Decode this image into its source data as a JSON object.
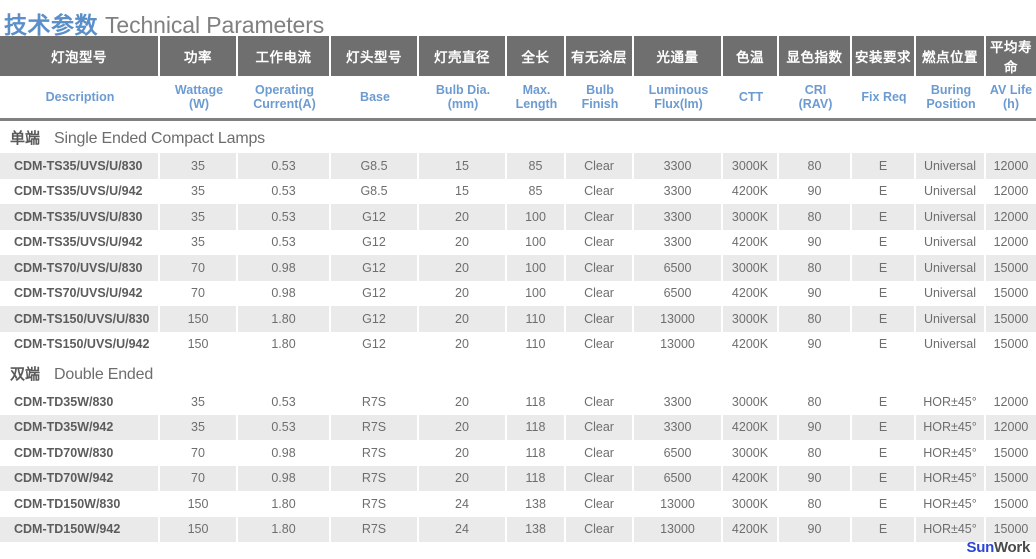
{
  "title": {
    "cn": "技术参数",
    "en": "Technical Parameters"
  },
  "columns": [
    {
      "cn": "灯泡型号",
      "en": "Description"
    },
    {
      "cn": "功率",
      "en": "Wattage\n(W)"
    },
    {
      "cn": "工作电流",
      "en": "Operating\nCurrent(A)"
    },
    {
      "cn": "灯头型号",
      "en": "Base"
    },
    {
      "cn": "灯壳直径",
      "en": "Bulb Dia.\n(mm)"
    },
    {
      "cn": "全长",
      "en": "Max.\nLength"
    },
    {
      "cn": "有无涂层",
      "en": "Bulb\nFinish"
    },
    {
      "cn": "光通量",
      "en": "Luminous\nFlux(lm)"
    },
    {
      "cn": "色温",
      "en": "CTT"
    },
    {
      "cn": "显色指数",
      "en": "CRI\n(RAV)"
    },
    {
      "cn": "安装要求",
      "en": "Fix Req"
    },
    {
      "cn": "燃点位置",
      "en": "Buring\nPosition"
    },
    {
      "cn": "平均寿命",
      "en": "AV Life\n(h)"
    }
  ],
  "sections": [
    {
      "cn": "单端",
      "en": "Single Ended Compact Lamps",
      "rows": [
        [
          "CDM-TS35/UVS/U/830",
          "35",
          "0.53",
          "G8.5",
          "15",
          "85",
          "Clear",
          "3300",
          "3000K",
          "80",
          "E",
          "Universal",
          "12000"
        ],
        [
          "CDM-TS35/UVS/U/942",
          "35",
          "0.53",
          "G8.5",
          "15",
          "85",
          "Clear",
          "3300",
          "4200K",
          "90",
          "E",
          "Universal",
          "12000"
        ],
        [
          "CDM-TS35/UVS/U/830",
          "35",
          "0.53",
          "G12",
          "20",
          "100",
          "Clear",
          "3300",
          "3000K",
          "80",
          "E",
          "Universal",
          "12000"
        ],
        [
          "CDM-TS35/UVS/U/942",
          "35",
          "0.53",
          "G12",
          "20",
          "100",
          "Clear",
          "3300",
          "4200K",
          "90",
          "E",
          "Universal",
          "12000"
        ],
        [
          "CDM-TS70/UVS/U/830",
          "70",
          "0.98",
          "G12",
          "20",
          "100",
          "Clear",
          "6500",
          "3000K",
          "80",
          "E",
          "Universal",
          "15000"
        ],
        [
          "CDM-TS70/UVS/U/942",
          "70",
          "0.98",
          "G12",
          "20",
          "100",
          "Clear",
          "6500",
          "4200K",
          "90",
          "E",
          "Universal",
          "15000"
        ],
        [
          "CDM-TS150/UVS/U/830",
          "150",
          "1.80",
          "G12",
          "20",
          "110",
          "Clear",
          "13000",
          "3000K",
          "80",
          "E",
          "Universal",
          "15000"
        ],
        [
          "CDM-TS150/UVS/U/942",
          "150",
          "1.80",
          "G12",
          "20",
          "110",
          "Clear",
          "13000",
          "4200K",
          "90",
          "E",
          "Universal",
          "15000"
        ]
      ]
    },
    {
      "cn": "双端",
      "en": "Double Ended",
      "rows": [
        [
          "CDM-TD35W/830",
          "35",
          "0.53",
          "R7S",
          "20",
          "118",
          "Clear",
          "3300",
          "3000K",
          "80",
          "E",
          "HOR±45°",
          "12000"
        ],
        [
          "CDM-TD35W/942",
          "35",
          "0.53",
          "R7S",
          "20",
          "118",
          "Clear",
          "3300",
          "4200K",
          "90",
          "E",
          "HOR±45°",
          "12000"
        ],
        [
          "CDM-TD70W/830",
          "70",
          "0.98",
          "R7S",
          "20",
          "118",
          "Clear",
          "6500",
          "3000K",
          "80",
          "E",
          "HOR±45°",
          "15000"
        ],
        [
          "CDM-TD70W/942",
          "70",
          "0.98",
          "R7S",
          "20",
          "118",
          "Clear",
          "6500",
          "4200K",
          "90",
          "E",
          "HOR±45°",
          "15000"
        ],
        [
          "CDM-TD150W/830",
          "150",
          "1.80",
          "R7S",
          "24",
          "138",
          "Clear",
          "13000",
          "3000K",
          "80",
          "E",
          "HOR±45°",
          "15000"
        ],
        [
          "CDM-TD150W/942",
          "150",
          "1.80",
          "R7S",
          "24",
          "138",
          "Clear",
          "13000",
          "4200K",
          "90",
          "E",
          "HOR±45°",
          "15000"
        ]
      ]
    }
  ],
  "watermark": {
    "part1": "Sun",
    "part2": "Work"
  },
  "colors": {
    "title_cn": "#5b8fc9",
    "title_en": "#808080",
    "header_bg": "#706f6f",
    "subheader_text": "#6c9bd2",
    "row_shade": "#eaeaea",
    "row_plain": "#ffffff",
    "body_text": "#6e6e6e",
    "watermark_blue": "#2b46d6",
    "watermark_gray": "#4a4a4a"
  }
}
